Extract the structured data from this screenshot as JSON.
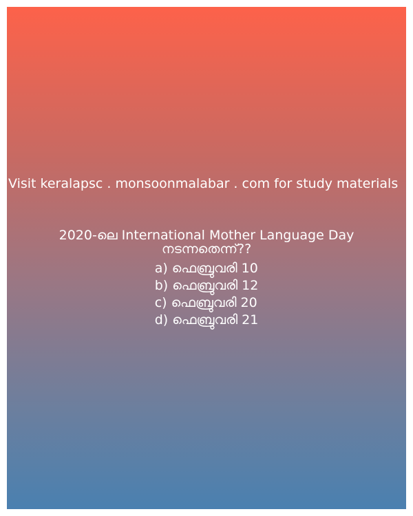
{
  "promo": {
    "text": "Visit keralapsc . monsoonmalabar . com for study materials"
  },
  "question": {
    "text": "2020-ലെ International Mother Language Day നടന്നതെന്ന്??",
    "options": [
      "a) ഫെബ്രുവരി 10",
      "b) ഫെബ്രുവരി 12",
      "c) ഫെബ്രുവരി 20",
      "d) ഫെബ്രുവരി 21"
    ]
  },
  "colors": {
    "gradient_top": "#fd624a",
    "gradient_bottom": "#4a80b0",
    "text": "#ffffff"
  }
}
